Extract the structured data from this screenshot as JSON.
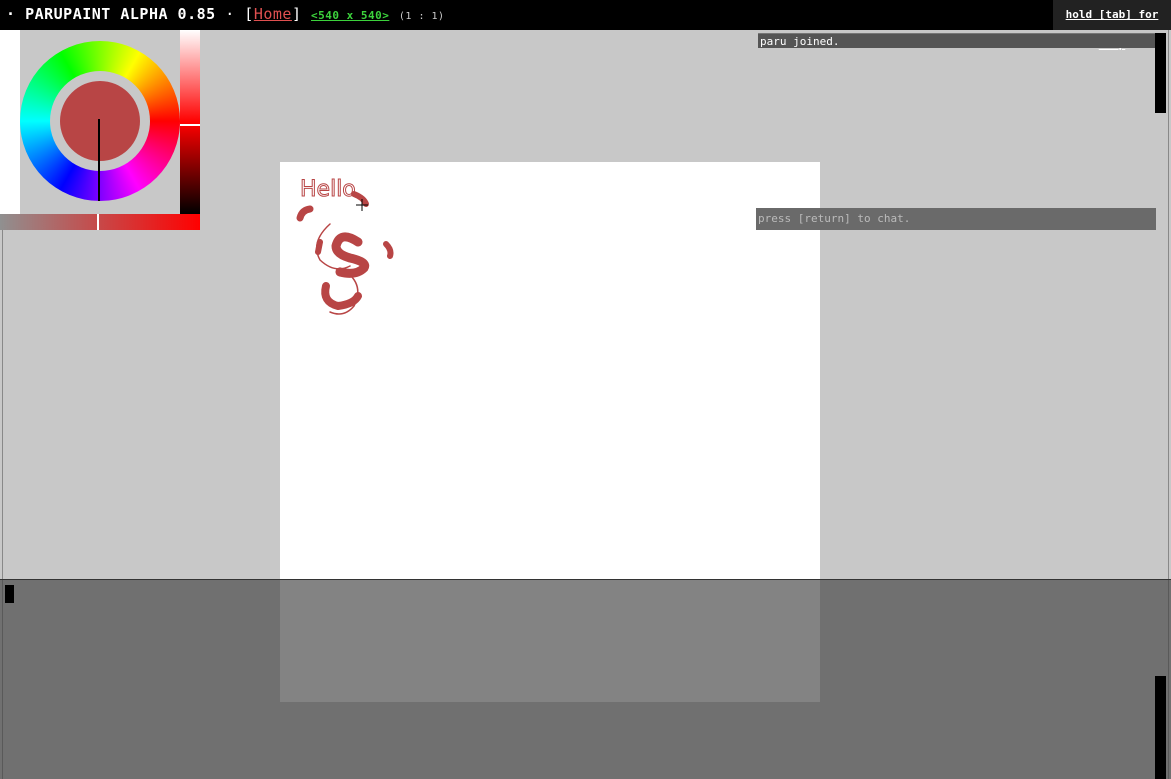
{
  "app": {
    "prefix": "· ",
    "name": "PARUPAINT ALPHA 0.85",
    "separator": " · ",
    "bracket_open": "[",
    "home_link": "Home",
    "bracket_close": "]",
    "canvas_size": "<540 x 540>",
    "zoom_ratio": "(1 : 1)",
    "help_link": "hold [tab] for help"
  },
  "colors": {
    "brush": "#b84545",
    "background": "#c8c8c8",
    "canvas": "#ffffff"
  },
  "chat": {
    "messages": [
      "paru joined."
    ],
    "input_placeholder": "press [return] to chat."
  },
  "canvas_drawing": {
    "handwritten_text": "Hello"
  }
}
